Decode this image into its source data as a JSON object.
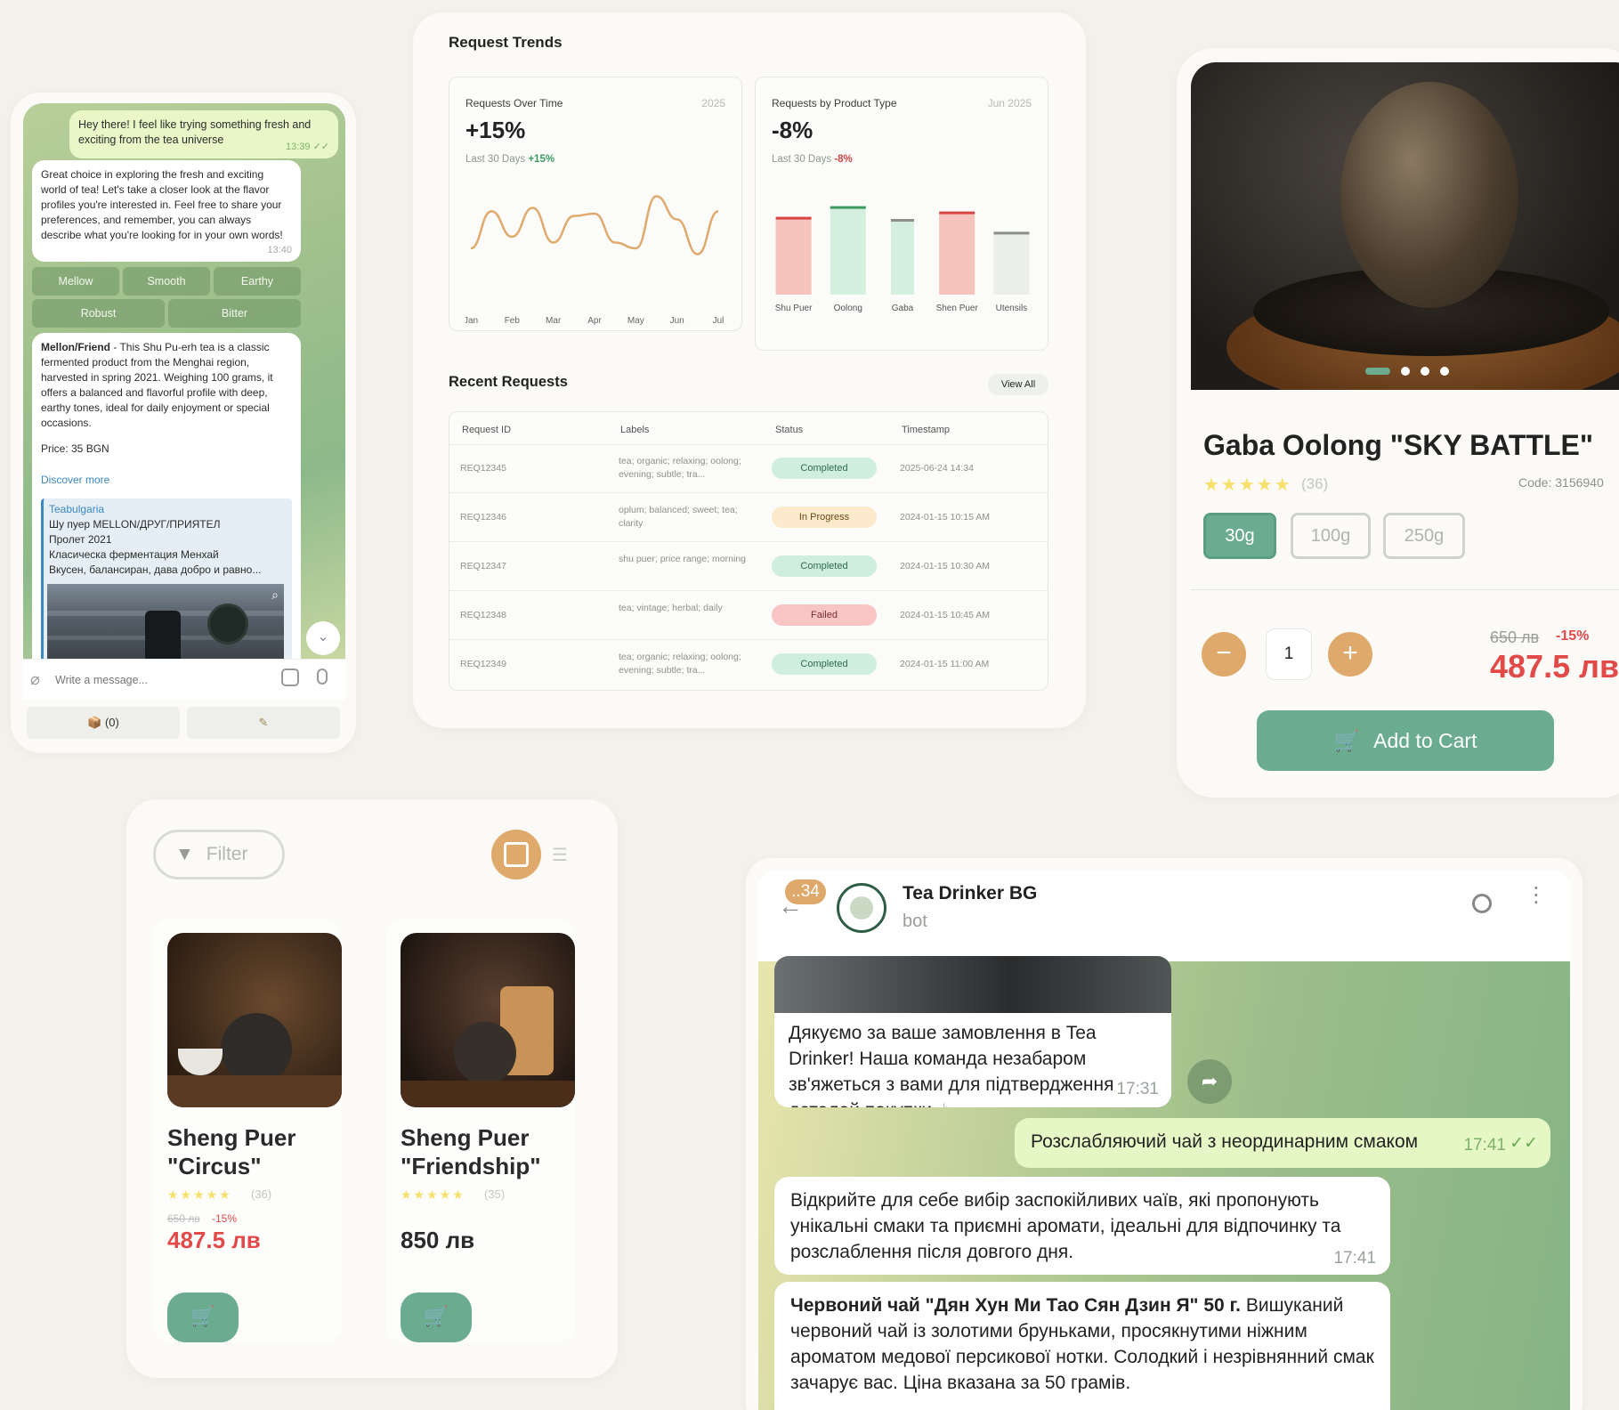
{
  "chat1": {
    "msg_out": "Hey there! I feel like trying something fresh and exciting from the tea universe",
    "msg_out_time": "13:39",
    "msg_in": "Great choice in exploring the fresh and exciting world of tea! Let's take a closer look at the flavor profiles you're interested in. Feel free to share your preferences, and remember, you can always describe what you're looking for in your own words!",
    "msg_in_time": "13:40",
    "keyboard_row1": [
      "Mellow",
      "Smooth",
      "Earthy"
    ],
    "keyboard_row2": [
      "Robust",
      "Bitter"
    ],
    "product_title": "Mellon/Friend",
    "product_desc": " - This Shu Pu-erh tea is a classic fermented product from the Menghai region, harvested in spring 2021. Weighing 100 grams, it offers a balanced and flavorful profile with deep, earthy tones, ideal for daily enjoyment or special occasions.",
    "price": "Price: 35 BGN",
    "discover_more": "Discover more",
    "preview_site": "Teabulgaria",
    "preview_line1": "Шу пуер MELLON/ДРУГ/ПРИЯТЕЛ",
    "preview_line2": "Пролет 2021",
    "preview_line3": "Класическа ферментация Менхай",
    "preview_line4": "Вкусен, балансиран, дава добро и равно...",
    "input_placeholder": "Write a message...",
    "cart_button": "(0)",
    "colors": {
      "bubble_out": "#e7f7c8",
      "keyboard": "#6e9664"
    }
  },
  "dashboard": {
    "title": "Request Trends",
    "card1_title": "Requests Over Time",
    "card1_period": "2025",
    "card1_big": "+15%",
    "card1_sub": "Last 30 Days",
    "card1_change": "+15%",
    "card2_title": "Requests by Product Type",
    "card2_period": "Jun 2025",
    "card2_big": "-8%",
    "card2_sub": "Last 30 Days",
    "card2_change": "-8%",
    "recent_title": "Recent Requests",
    "view_all": "View All",
    "table_headers": [
      "Request ID",
      "Labels",
      "Status",
      "Timestamp"
    ],
    "rows": [
      {
        "id": "REQ12345",
        "labels": "tea; organic; relaxing; oolong; evening; subtle; tra...",
        "status": "Completed",
        "kind": "ok",
        "time": "2025-06-24 14:34"
      },
      {
        "id": "REQ12346",
        "labels": "oplum; balanced; sweet; tea; clarity",
        "status": "In Progress",
        "kind": "prog",
        "time": "2024-01-15 10:15 AM"
      },
      {
        "id": "REQ12347",
        "labels": "shu puer; price range; morning",
        "status": "Completed",
        "kind": "ok",
        "time": "2024-01-15 10:30 AM"
      },
      {
        "id": "REQ12348",
        "labels": "tea; vintage; herbal; daily",
        "status": "Failed",
        "kind": "fail",
        "time": "2024-01-15 10:45 AM"
      },
      {
        "id": "REQ12349",
        "labels": "tea; organic; relaxing; oolong; evening; subtle; tra...",
        "status": "Completed",
        "kind": "ok",
        "time": "2024-01-15 11:00 AM"
      }
    ]
  },
  "chart_data": [
    {
      "type": "line",
      "title": "Requests Over Time",
      "categories": [
        "Jan",
        "Feb",
        "Mar",
        "Apr",
        "May",
        "Jun",
        "Jul"
      ],
      "x": [
        0,
        0.5,
        1,
        1.5,
        2,
        2.5,
        3,
        3.5,
        4,
        4.5,
        5,
        5.5,
        6
      ],
      "y": [
        40,
        72,
        50,
        75,
        45,
        68,
        70,
        45,
        40,
        85,
        65,
        35,
        72
      ],
      "ylim": [
        0,
        100
      ],
      "color": "#e0a96d"
    },
    {
      "type": "bar",
      "title": "Requests by Product Type",
      "categories": [
        "Shu Puer",
        "Oolong",
        "Gaba",
        "Shen Puer",
        "Utensils"
      ],
      "values": [
        72,
        82,
        70,
        77,
        58
      ],
      "ylim": [
        0,
        100
      ],
      "fill_colors": [
        "#f6c3bd",
        "#d5efdf",
        "#d5efdf",
        "#f6c3bd",
        "#ebeeea"
      ],
      "cap_colors": [
        "#d84343",
        "#3d9b60",
        "#8a8f8a",
        "#d84343",
        "#8a8f8a"
      ]
    }
  ],
  "product": {
    "name": "Gaba Oolong \"SKY BATTLE\"",
    "rating_stars": 5,
    "rating_count": "(36)",
    "code": "Code: 3156940",
    "weights": [
      "30g",
      "100g",
      "250g"
    ],
    "selected_weight": "30g",
    "quantity": "1",
    "old_price": "650 лв",
    "discount": "-15%",
    "price": "487.5 лв",
    "add_to_cart": "Add to Cart",
    "carousel_count": 4,
    "colors": {
      "accent": "#6bac90",
      "price": "#e24a4a",
      "stepper": "#dfa96c"
    }
  },
  "catalog": {
    "filter": "Filter",
    "items": [
      {
        "name_line1": "Sheng Puer",
        "name_line2": "\"Circus\"",
        "rating_count": "(36)",
        "old_price": "650 лв",
        "discount": "-15%",
        "price": "487.5 лв"
      },
      {
        "name_line1": "Sheng Puer",
        "name_line2": "\"Friendship\"",
        "rating_count": "(35)",
        "price": "850 лв"
      }
    ]
  },
  "chat2": {
    "unread": "..34",
    "bot_name": "Tea Drinker BG",
    "bot_status": "bot",
    "msg1": "Дякуємо за ваше замовлення в Tea Drinker! Наша команда незабаром зв'яжеться з вами для підтвердження деталей покупки ☕",
    "msg1_time": "17:31",
    "msg2": "Розслабляючий чай з неординарним смаком",
    "msg2_time": "17:41",
    "msg3": "Відкрийте для себе вибір заспокійливих чаїв, які пропонують унікальні смаки та приємні аромати, ідеальні для відпочинку та розслаблення після довгого дня.",
    "msg3_time": "17:41",
    "msg4_bold": "Червоний чай \"Дян Хун Ми Тао Сян Дзин Я\" 50 г.",
    "msg4_rest": " Вишуканий червоний чай із золотими бруньками, просякнутими ніжним ароматом медової персикової нотки. Солодкий і незрівнянний смак зачарує вас. Ціна вказана за 50 грамів."
  }
}
